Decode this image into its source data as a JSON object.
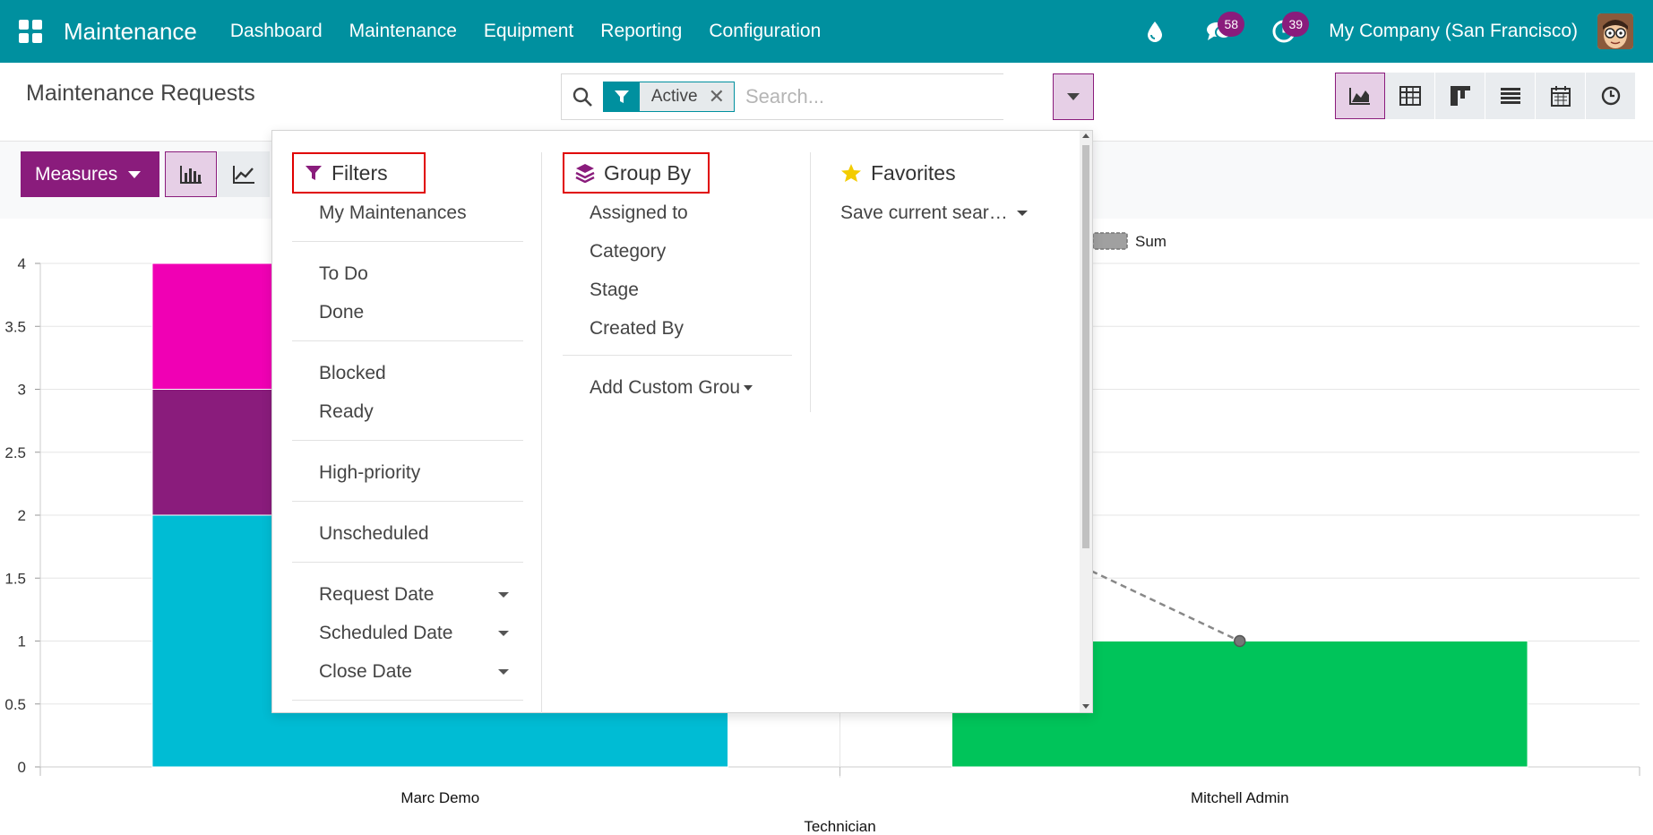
{
  "navbar": {
    "app_name": "Maintenance",
    "menu": [
      "Dashboard",
      "Maintenance",
      "Equipment",
      "Reporting",
      "Configuration"
    ],
    "messages_count": "58",
    "activities_count": "39",
    "company": "My Company (San Francisco)",
    "bg_color": "#00909f"
  },
  "control_panel": {
    "title": "Maintenance Requests",
    "search": {
      "facet_label": "Active",
      "placeholder": "Search..."
    },
    "views": [
      "graph-icon",
      "pivot-icon",
      "kanban-icon",
      "list-icon",
      "calendar-icon",
      "activity-icon"
    ]
  },
  "toolbar": {
    "measures_label": "Measures"
  },
  "dropdown": {
    "filters": {
      "title": "Filters",
      "groups": [
        [
          "My Maintenances"
        ],
        [
          "To Do",
          "Done"
        ],
        [
          "Blocked",
          "Ready"
        ],
        [
          "High-priority"
        ],
        [
          "Unscheduled"
        ],
        [
          "Request Date",
          "Scheduled Date",
          "Close Date"
        ]
      ]
    },
    "group_by": {
      "title": "Group By",
      "items": [
        "Assigned to",
        "Category",
        "Stage",
        "Created By"
      ],
      "custom": "Add Custom Grou"
    },
    "favorites": {
      "title": "Favorites",
      "save": "Save current sear…"
    }
  },
  "chart_data": {
    "type": "bar",
    "stacked": true,
    "categories": [
      "Marc Demo",
      "Mitchell Admin"
    ],
    "series": [
      {
        "color": "#00bcd4",
        "values": [
          2,
          1
        ]
      },
      {
        "color": "#8a1c7c",
        "values": [
          1,
          0
        ]
      },
      {
        "color": "#f000b4",
        "values": [
          1,
          0
        ]
      }
    ],
    "mitchell_color": "#00c45a",
    "sum_line": {
      "name": "Sum",
      "values": [
        4,
        1
      ]
    },
    "xlabel": "Technician",
    "ylabel": "",
    "ylim": [
      0,
      4
    ],
    "yticks": [
      "0",
      "0.5",
      "1",
      "1.5",
      "2",
      "2.5",
      "3",
      "3.5",
      "4"
    ],
    "grid": true
  }
}
